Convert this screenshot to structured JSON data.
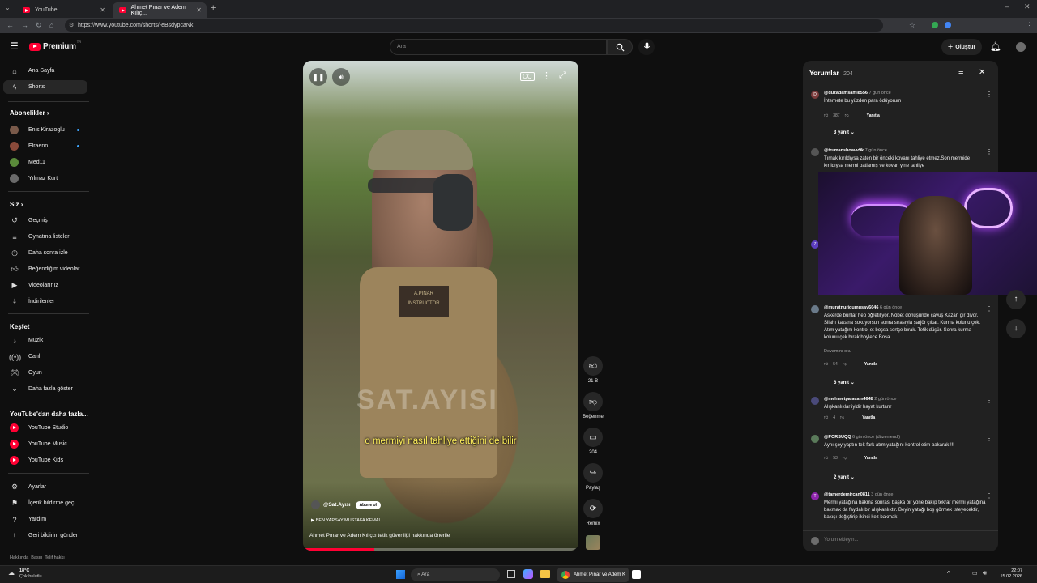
{
  "browser": {
    "tabs": [
      {
        "title": "YouTube"
      },
      {
        "title": "Ahmet Pınar ve Adem Kılıç..."
      }
    ],
    "url": "https://www.youtube.com/shorts/-eBsdypcaNk",
    "new_tab": "+"
  },
  "header": {
    "logo_text": "Premium",
    "logo_sup": "TR",
    "search_placeholder": "Ara",
    "create_label": "Oluştur"
  },
  "sidebar": {
    "top": [
      {
        "label": "Ana Sayfa",
        "icon": "home-icon"
      },
      {
        "label": "Shorts",
        "icon": "shorts-icon"
      }
    ],
    "subs_heading": "Abonelikler",
    "subs": [
      {
        "label": "Enis Kirazoglu",
        "color": "#7a5a4a"
      },
      {
        "label": "Elraenn",
        "color": "#8a4a3a"
      },
      {
        "label": "Med11",
        "color": "#5a8a3a"
      },
      {
        "label": "Yılmaz Kurt",
        "color": "#6a6a6a"
      }
    ],
    "you_heading": "Siz",
    "you": [
      {
        "label": "Geçmiş"
      },
      {
        "label": "Oynatma listeleri"
      },
      {
        "label": "Daha sonra izle"
      },
      {
        "label": "Beğendiğim videolar"
      },
      {
        "label": "Videolarınız"
      },
      {
        "label": "İndirilenler"
      }
    ],
    "explore_heading": "Keşfet",
    "explore": [
      {
        "label": "Müzik"
      },
      {
        "label": "Canlı"
      },
      {
        "label": "Oyun"
      },
      {
        "label": "Daha fazla göster"
      }
    ],
    "more_heading": "YouTube'dan daha fazla...",
    "more": [
      {
        "label": "YouTube Studio"
      },
      {
        "label": "YouTube Music"
      },
      {
        "label": "YouTube Kids"
      }
    ],
    "settings": [
      {
        "label": "Ayarlar"
      },
      {
        "label": "İçerik bildirme geç..."
      },
      {
        "label": "Yardım"
      },
      {
        "label": "Geri bildirim gönder"
      }
    ],
    "footer": "Hakkında  Basın  Telif hakkı"
  },
  "video": {
    "subtitle": "o mermiyi nasıl tahliye ettiğini de bilir",
    "watermark": "SAT.AYISI",
    "channel": "@Sat.Ayısı",
    "subscribe": "Abone ol",
    "music": "BEN YAPSAY MUSTAFA KEMAL",
    "title": "Ahmet Pınar ve Adem Kılıçcı tetik güvenliği hakkında önerile",
    "patch_name": "A.PINAR",
    "patch_role": "INSTRUCTOR",
    "progress_fraction": 0.26
  },
  "actions": {
    "likes": "21 B",
    "dislike": "Beğenme",
    "comments": "204",
    "share": "Paylaş",
    "remix": "Remix"
  },
  "comments_panel": {
    "title": "Yorumlar",
    "count": "204",
    "input_placeholder": "Yorum ekleyin...",
    "items": [
      {
        "user": "@duzadamsami8556",
        "time": "7 gün önce",
        "text": "İnternete bu yüzden para ödüyorum",
        "likes": "387",
        "reply": "Yanıtla",
        "replies": "3 yanıt",
        "av": "D",
        "avc": "#7b3b3b"
      },
      {
        "user": "@trumanshow-v9k",
        "time": "7 gün önce",
        "text": "Tırnak kırıldıysa zaten bir önceki kovanı tahliye etmez.Son mermide kırıldıysa mermi patlamış ve kovan yine tahliye",
        "av": "",
        "avc": "#555"
      },
      {
        "user": "@muratnurigumusay6046",
        "time": "6 gün önce",
        "text": "Askerde bunlar hep öğretiliyor. Nöbet dönüşünde çavuş Kazan gir diyor. Silahı kazana sokuyorsun sonra sırasıyla şarjör çıkar. Kurma kolunu çek. Atım yatağını kontrol et boşsa sertçe bırak. Tetik düşür. Sonra kurma kolunu çek bırak.boylece  Boşa...",
        "more": "Devamını oku",
        "likes": "54",
        "reply": "Yanıtla",
        "replies": "6 yanıt",
        "av": "",
        "avc": "#6a7a8a"
      },
      {
        "user": "@mehmetpalacam4648",
        "time": "2 gün önce",
        "text": "Alışkanlıklar iyidir hayat kurtarır",
        "likes": "4",
        "reply": "Yanıtla",
        "av": "",
        "avc": "#4a4a7a"
      },
      {
        "user": "@PORSUQQ",
        "time": "6 gün önce (düzenlendi)",
        "text": "Aynı şey yaptın tek fark atım yatağını kontrol etim bakarak  !!!",
        "likes": "53",
        "reply": "Yanıtla",
        "replies": "2 yanıt",
        "av": "",
        "avc": "#5a7a5a"
      },
      {
        "user": "@tamerdemircan0811",
        "time": "3 gün önce",
        "text": "Mermi yatağına bakma sonrası başka bir yöne bakıp tekrar mermi yatağına bakmak da faydalı bir alışkanlıktır. Beyin yatağı boş görmek isteyecektir, bakışı değiştirip ikinci kez bakmak",
        "av": "T",
        "avc": "#8e24aa"
      }
    ]
  },
  "taskbar": {
    "weather_temp": "18°C",
    "weather_desc": "Çok bulutlu",
    "search": "Ara",
    "active_app": "Ahmet Pınar ve Adem K",
    "time": "22:07",
    "date": "15.02.2026"
  },
  "colors": {
    "brand": "#ff0033",
    "accent": "#3ea6ff",
    "bg": "#0f0f0f"
  }
}
